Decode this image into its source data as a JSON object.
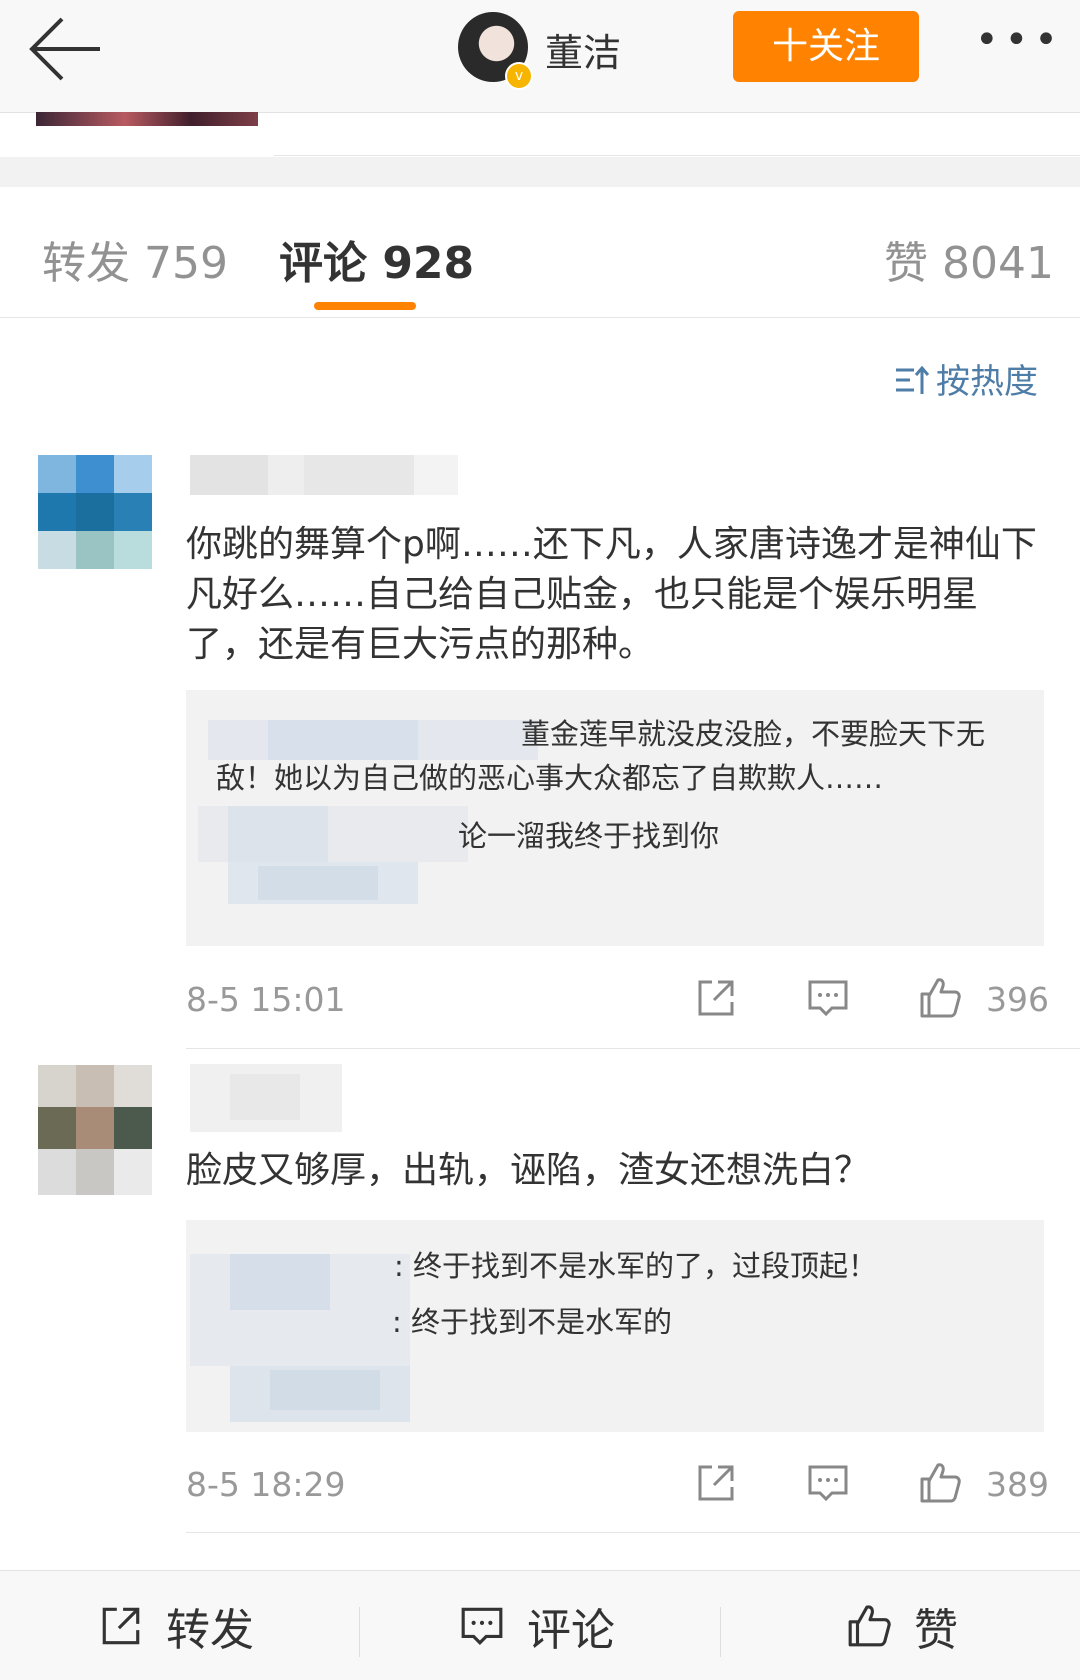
{
  "header": {
    "author_name": "董洁",
    "follow_label": "十关注",
    "more_label": "•••"
  },
  "tabs": [
    {
      "label": "转发 759"
    },
    {
      "label": "评论 928",
      "active": true
    },
    {
      "label": "赞 8041"
    }
  ],
  "sort": {
    "label": "按热度"
  },
  "comments": [
    {
      "text": "你跳的舞算个p啊……还下凡，人家唐诗逸才是神仙下凡好么……自己给自己贴金，也只能是个娱乐明星了，还是有巨大污点的那种。",
      "replies": [
        "董金莲早就没皮没脸，不要脸天下无敌！她以为自己做的恶心事大众都忘了自欺欺人……",
        "论一溜我终于找到你"
      ],
      "time": "8-5 15:01",
      "likes": "396"
    },
    {
      "text": "脸皮又够厚，出轨，诬陷，渣女还想洗白？",
      "replies": [
        ": 终于找到不是水军的了，过段顶起！",
        ": 终于找到不是水军的"
      ],
      "time": "8-5 18:29",
      "likes": "389"
    }
  ],
  "bottom_bar": {
    "repost_label": "转发",
    "comment_label": "评论",
    "like_label": "赞"
  },
  "colors": {
    "accent": "#ff8200",
    "link": "#4e7da7",
    "verified": "#f7b500"
  }
}
